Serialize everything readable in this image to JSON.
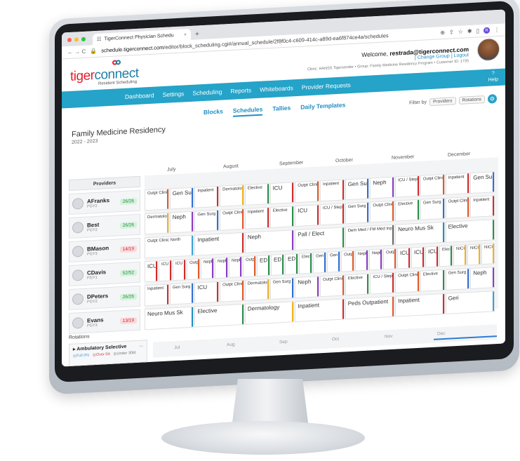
{
  "browser": {
    "tab_title": "TigerConnect Physician Schedu",
    "tab_close": "×",
    "new_tab": "+",
    "url_host": "schedule.tigerconnect.com",
    "url_path": "/editor/block_scheduling.cgi#/annual_schedule/2f8f0c4-c609-414c-a89d-ea6f874ce4a/schedules",
    "nav_glyphs": "← → C",
    "profile_letter": "R"
  },
  "header": {
    "brand_tiger": "tiger",
    "brand_connect": "connect",
    "brand_sub": "Resident Scheduling",
    "welcome_prefix": "Welcome,",
    "user_email": "restrada@tigerconnect.com",
    "links": "[ Change Group ] Logout",
    "clinic_line": "Clinic: HANSS Tigersender • Group: Family Medicine Residency Program • Customer ID: 1735"
  },
  "nav": {
    "items": [
      "Dashboard",
      "Settings",
      "Scheduling",
      "Reports",
      "Whiteboards",
      "Provider Requests"
    ],
    "help_q": "?",
    "help_label": "Help"
  },
  "subtabs": {
    "items": [
      "Blocks",
      "Schedules",
      "Tallies",
      "Daily Templates"
    ],
    "active": "Schedules",
    "filter_label": "Filter by",
    "filter_chips": [
      "Providers",
      "Rotations"
    ]
  },
  "program": {
    "name": "Family Medicine Residency",
    "year": "2022 - 2023"
  },
  "schedule": {
    "months": [
      "July",
      "August",
      "September",
      "October",
      "November",
      "December"
    ],
    "providers_header": "Providers",
    "providers": [
      {
        "name": "AFranks",
        "pgy": "PGY2",
        "count": "26/26",
        "status": "ok"
      },
      {
        "name": "Best",
        "pgy": "PGY2",
        "count": "26/26",
        "status": "ok"
      },
      {
        "name": "BMason",
        "pgy": "PGY3",
        "count": "14/19",
        "status": "bad"
      },
      {
        "name": "CDavis",
        "pgy": "PGY1",
        "count": "52/52",
        "status": "ok"
      },
      {
        "name": "DPeters",
        "pgy": "PGY2",
        "count": "26/26",
        "status": "ok"
      },
      {
        "name": "Evans",
        "pgy": "PGY3",
        "count": "13/19",
        "status": "bad"
      }
    ],
    "rows": [
      [
        {
          "label": "Outpt Clinic South",
          "c": "#e05a2a"
        },
        {
          "label": "Gen Surg",
          "c": "#2e6fd6",
          "big": true
        },
        {
          "label": "Inpatient",
          "c": "#d12c2c"
        },
        {
          "label": "Dermatology",
          "c": "#f2b320"
        },
        {
          "label": "Elective",
          "c": "#2a8f4a"
        },
        {
          "label": "ICU",
          "c": "#d12c2c",
          "big": true
        },
        {
          "label": "Outpt Clinic South",
          "c": "#e05a2a"
        },
        {
          "label": "Inpatient",
          "c": "#d12c2c"
        },
        {
          "label": "Gen Surg",
          "c": "#2e6fd6",
          "big": true
        },
        {
          "label": "Neph",
          "c": "#8a3dc4",
          "big": true
        },
        {
          "label": "ICU / Step Down",
          "c": "#d12c2c"
        },
        {
          "label": "Outpt Clinic South",
          "c": "#e05a2a"
        },
        {
          "label": "Inpatient",
          "c": "#d12c2c"
        },
        {
          "label": "Gen Sur",
          "c": "#2e6fd6",
          "big": true
        }
      ],
      [
        {
          "label": "Dermatology",
          "c": "#f2b320"
        },
        {
          "label": "Neph",
          "c": "#8a3dc4",
          "big": true
        },
        {
          "label": "Gen Surg",
          "c": "#2e6fd6"
        },
        {
          "label": "Outpt Clinic South",
          "c": "#e05a2a"
        },
        {
          "label": "Inpatient",
          "c": "#d12c2c"
        },
        {
          "label": "Elective",
          "c": "#2a8f4a"
        },
        {
          "label": "ICU",
          "c": "#d12c2c",
          "big": true
        },
        {
          "label": "ICU / Step Down",
          "c": "#d12c2c"
        },
        {
          "label": "Gen Surg",
          "c": "#2e6fd6"
        },
        {
          "label": "Outpt Clinic South",
          "c": "#e05a2a"
        },
        {
          "label": "Elective",
          "c": "#2a8f4a"
        },
        {
          "label": "Gen Surg",
          "c": "#2e6fd6"
        },
        {
          "label": "Outpt Clinic South",
          "c": "#e05a2a"
        },
        {
          "label": "Inpatient",
          "c": "#d12c2c"
        }
      ],
      [
        {
          "label": "Outpt Clinic North",
          "c": "#3aa0d8"
        },
        {
          "label": "Inpatient",
          "c": "#d12c2c",
          "big": true
        },
        {
          "label": "Neph",
          "c": "#8a3dc4",
          "big": true
        },
        {
          "label": "Pall / Elect",
          "c": "#2a8f4a",
          "big": true
        },
        {
          "label": "Dem Med / FM Med Inp",
          "c": "#6a6a6a"
        },
        {
          "label": "Neuro Mus Sk",
          "c": "#1f8fc2",
          "big": true
        },
        {
          "label": "Elective",
          "c": "#2a8f4a",
          "big": true
        }
      ],
      [
        {
          "label": "ICU",
          "c": "#d12c2c",
          "big": true
        },
        {
          "label": "ICU",
          "c": "#d12c2c"
        },
        {
          "label": "ICU",
          "c": "#d12c2c"
        },
        {
          "label": "Outpt",
          "c": "#e05a2a"
        },
        {
          "label": "Neph",
          "c": "#8a3dc4"
        },
        {
          "label": "Neph",
          "c": "#8a3dc4"
        },
        {
          "label": "Neph",
          "c": "#8a3dc4"
        },
        {
          "label": "Outpt",
          "c": "#e05a2a"
        },
        {
          "label": "ED",
          "c": "#2a8f4a",
          "big": true
        },
        {
          "label": "ED",
          "c": "#2a8f4a",
          "big": true
        },
        {
          "label": "ED",
          "c": "#2a8f4a",
          "big": true
        },
        {
          "label": "Elective",
          "c": "#2a8f4a"
        },
        {
          "label": "Gen Su",
          "c": "#2e6fd6"
        },
        {
          "label": "Gen Su",
          "c": "#2e6fd6"
        },
        {
          "label": "Outpt",
          "c": "#e05a2a"
        },
        {
          "label": "Neph",
          "c": "#8a3dc4"
        },
        {
          "label": "Neph",
          "c": "#8a3dc4"
        },
        {
          "label": "Outpt",
          "c": "#e05a2a"
        },
        {
          "label": "ICU",
          "c": "#d12c2c",
          "big": true
        },
        {
          "label": "ICU",
          "c": "#d12c2c",
          "big": true
        },
        {
          "label": "ICU",
          "c": "#d12c2c",
          "big": true
        },
        {
          "label": "Elective",
          "c": "#2a8f4a"
        },
        {
          "label": "NICU",
          "c": "#f2b320"
        },
        {
          "label": "NICU",
          "c": "#f2b320"
        },
        {
          "label": "NICU",
          "c": "#f2b320"
        }
      ],
      [
        {
          "label": "Inpatient",
          "c": "#d12c2c"
        },
        {
          "label": "Gen Surg",
          "c": "#2e6fd6"
        },
        {
          "label": "ICU",
          "c": "#d12c2c",
          "big": true
        },
        {
          "label": "Outpt Clinic South",
          "c": "#e05a2a"
        },
        {
          "label": "Dermatology",
          "c": "#f2b320"
        },
        {
          "label": "Gen Surg",
          "c": "#2e6fd6"
        },
        {
          "label": "Neph",
          "c": "#8a3dc4",
          "big": true
        },
        {
          "label": "Outpt Clinic South",
          "c": "#e05a2a"
        },
        {
          "label": "Elective",
          "c": "#2a8f4a"
        },
        {
          "label": "ICU / Step Down",
          "c": "#d12c2c"
        },
        {
          "label": "Outpt Clinic South",
          "c": "#e05a2a"
        },
        {
          "label": "Elective",
          "c": "#2a8f4a"
        },
        {
          "label": "Gen Surg",
          "c": "#2e6fd6"
        },
        {
          "label": "Neph",
          "c": "#8a3dc4",
          "big": true
        }
      ],
      [
        {
          "label": "Neuro Mus Sk",
          "c": "#1f8fc2",
          "big": true
        },
        {
          "label": "Elective",
          "c": "#2a8f4a",
          "big": true
        },
        {
          "label": "Dermatology",
          "c": "#f2b320",
          "big": true
        },
        {
          "label": "Inpatient",
          "c": "#d12c2c",
          "big": true
        },
        {
          "label": "Peds Outpatient",
          "c": "#e05a2a",
          "big": true
        },
        {
          "label": "Inpatient",
          "c": "#d12c2c",
          "big": true
        },
        {
          "label": "Geri",
          "c": "#3aa0d8",
          "big": true
        }
      ]
    ]
  },
  "rotations": {
    "label": "Rotations",
    "card_title": "Ambulatory Selective",
    "card_more": "...",
    "full": "Full 0%",
    "over": "Over 0d",
    "under": "Under 30ld",
    "months": [
      "Jul",
      "Aug",
      "Sep",
      "Oct",
      "Nov",
      "Dec"
    ]
  }
}
